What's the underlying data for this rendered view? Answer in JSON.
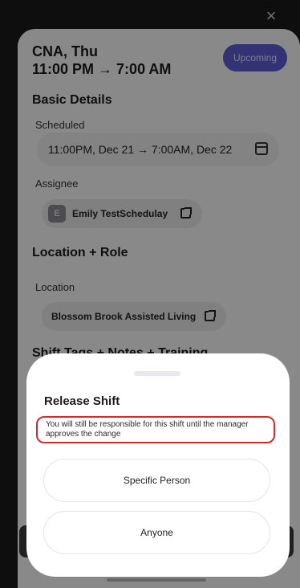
{
  "close_symbol": "×",
  "shift": {
    "line1": "CNA, Thu",
    "line2": "11:00 PM → 7:00 AM",
    "status_badge": "Upcoming"
  },
  "basic_details": {
    "heading": "Basic Details",
    "scheduled_label": "Scheduled",
    "scheduled_value": "11:00PM, Dec 21 → 7:00AM, Dec 22",
    "assignee_label": "Assignee",
    "assignee_initial": "E",
    "assignee_name": "Emily TestSchedulay"
  },
  "location_role": {
    "heading": "Location + Role",
    "location_label": "Location",
    "location_value": "Blossom Brook Assisted Living"
  },
  "next_section_heading": "Shift Tags + Notes + Training",
  "release_modal": {
    "title": "Release Shift",
    "warning": "You will still be responsible for this shift until the manager approves the change",
    "options": [
      "Specific Person",
      "Anyone"
    ]
  },
  "colors": {
    "accent": "#5b5bd6",
    "warning_border": "#d42a2a"
  }
}
